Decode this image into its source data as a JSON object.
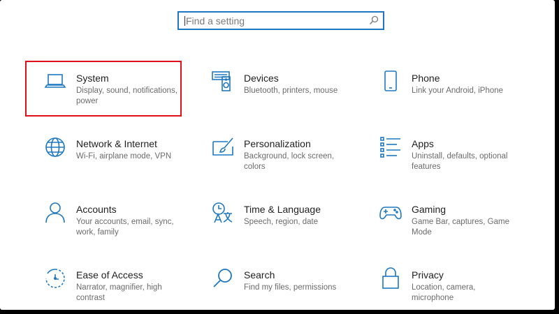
{
  "search": {
    "placeholder": "Find a setting"
  },
  "colors": {
    "accent": "#1d78c1",
    "highlight": "#e0101a"
  },
  "tiles": [
    {
      "title": "System",
      "desc": "Display, sound, notifications, power",
      "icon": "laptop-icon"
    },
    {
      "title": "Devices",
      "desc": "Bluetooth, printers, mouse",
      "icon": "keyboard-speaker-icon"
    },
    {
      "title": "Phone",
      "desc": "Link your Android, iPhone",
      "icon": "phone-icon"
    },
    {
      "title": "Network & Internet",
      "desc": "Wi-Fi, airplane mode, VPN",
      "icon": "globe-icon"
    },
    {
      "title": "Personalization",
      "desc": "Background, lock screen, colors",
      "icon": "paint-brush-icon"
    },
    {
      "title": "Apps",
      "desc": "Uninstall, defaults, optional features",
      "icon": "apps-list-icon"
    },
    {
      "title": "Accounts",
      "desc": "Your accounts, email, sync, work, family",
      "icon": "person-icon"
    },
    {
      "title": "Time & Language",
      "desc": "Speech, region, date",
      "icon": "time-language-icon"
    },
    {
      "title": "Gaming",
      "desc": "Game Bar, captures, Game Mode",
      "icon": "gamepad-icon"
    },
    {
      "title": "Ease of Access",
      "desc": "Narrator, magnifier, high contrast",
      "icon": "ease-of-access-icon"
    },
    {
      "title": "Search",
      "desc": "Find my files, permissions",
      "icon": "magnifier-icon"
    },
    {
      "title": "Privacy",
      "desc": "Location, camera, microphone",
      "icon": "lock-icon"
    }
  ]
}
